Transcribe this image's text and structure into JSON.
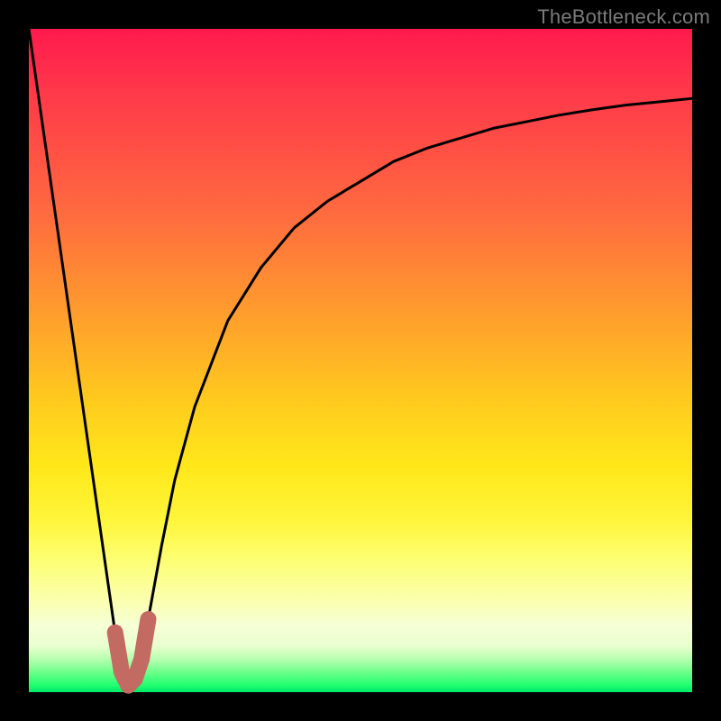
{
  "watermark": "TheBottleneck.com",
  "colors": {
    "frame": "#000000",
    "curve_main": "#000000",
    "curve_accent": "#c36a62",
    "gradient_top": "#ff1a4d",
    "gradient_bottom": "#00e86a"
  },
  "chart_data": {
    "type": "line",
    "title": "",
    "xlabel": "",
    "ylabel": "",
    "xlim": [
      0,
      100
    ],
    "ylim": [
      0,
      100
    ],
    "grid": false,
    "legend": false,
    "series": [
      {
        "name": "bottleneck-curve",
        "x": [
          0,
          4,
          8,
          12,
          13,
          14,
          15,
          16,
          17,
          18,
          20,
          22,
          25,
          30,
          35,
          40,
          45,
          50,
          55,
          60,
          65,
          70,
          75,
          80,
          85,
          90,
          95,
          100
        ],
        "values": [
          100,
          72,
          44,
          16,
          9,
          3,
          1,
          2,
          5,
          11,
          22,
          32,
          43,
          56,
          64,
          70,
          74,
          77,
          80,
          82,
          83.5,
          85,
          86,
          87,
          87.8,
          88.5,
          89,
          89.5
        ]
      },
      {
        "name": "bottleneck-accent-segment",
        "x": [
          13,
          14,
          15,
          16,
          17,
          18
        ],
        "values": [
          9,
          3,
          1,
          2,
          5,
          11
        ]
      }
    ],
    "annotations": []
  }
}
